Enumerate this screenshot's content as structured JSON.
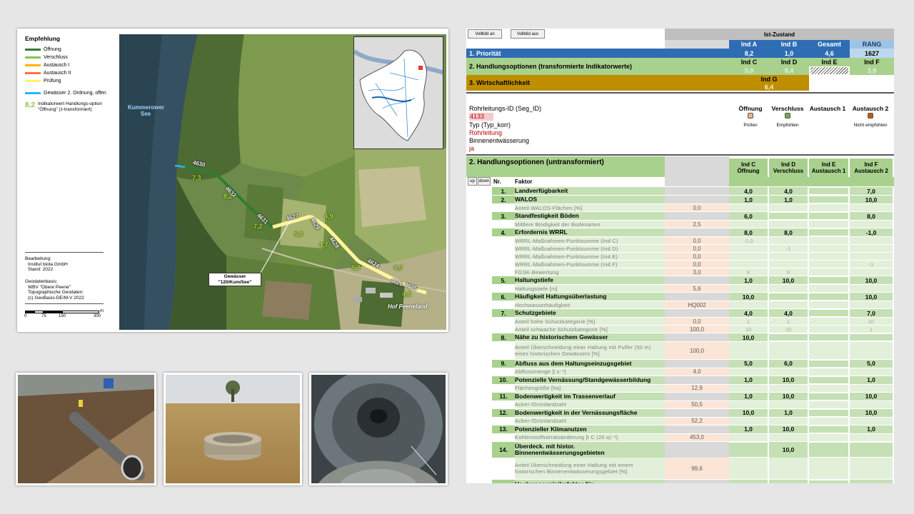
{
  "map": {
    "legend_title": "Empfehlung",
    "legend_items": [
      {
        "label": "Öffnung",
        "color": "#2e7d32"
      },
      {
        "label": "Verschluss",
        "color": "#8bc34a"
      },
      {
        "label": "Austausch I",
        "color": "#ffb300"
      },
      {
        "label": "Austausch II",
        "color": "#ff7043"
      },
      {
        "label": "Prüfung",
        "color": "#fff176"
      }
    ],
    "legend_water": {
      "label": "Gewässer 2. Ordnung, offen",
      "color": "#29b6f6"
    },
    "legend_indicator": {
      "value": "8,2",
      "text": "Indikatorwert Handlungs-option \"Öffnung\" (z-transformiert)"
    },
    "bearbeitung": [
      "Bearbeitung:",
      "Institut biota GmbH",
      "Stand: 2022"
    ],
    "geodaten": [
      "Geodatenbasis:",
      "WBV \"Obere Peene\"",
      "Topographische Geodaten:",
      "(c) GeoBasis-DE/M-V 2022"
    ],
    "scale_labels": [
      "0",
      "75",
      "150",
      "300"
    ],
    "scale_unit": "m",
    "lake_name": "Kummerower See",
    "hof_name": "Hof Peeneland",
    "gewaesser_label": [
      "Gewässer",
      "\"120/Kum/See\""
    ],
    "segments": [
      {
        "id": "4630",
        "ind": "7,3"
      },
      {
        "id": "4632",
        "ind": "8,2"
      },
      {
        "id": "4631",
        "ind": "7,2"
      },
      {
        "id": "4627",
        "ind": "5,3"
      },
      {
        "id": "4629",
        "ind": "4,9"
      },
      {
        "id": "4628",
        "ind": "4,7"
      },
      {
        "id": "4624",
        "ind": "5,3"
      },
      {
        "id": "4626",
        "ind": "4,9"
      },
      {
        "id": "4625",
        "ind": "4,8"
      }
    ]
  },
  "sheet": {
    "buttons": [
      "Vollbild an",
      "Vollbild aus"
    ],
    "ist_zustand": "Ist-Zustand",
    "top_headers": [
      "Ind A",
      "Ind B",
      "Gesamt",
      "RANG"
    ],
    "prioritaet": {
      "label": "1. Priorität",
      "values": [
        "8,2",
        "1,0",
        "4,6",
        "1627"
      ]
    },
    "handlungsoptionen_t": {
      "label": "2. Handlungsoptionen (transformierte Indikatorwerte)",
      "headers": [
        "Ind C",
        "Ind D",
        "Ind E",
        "Ind F"
      ],
      "values": [
        "5,0",
        "8,4",
        "",
        "3,9"
      ]
    },
    "wirtschaft": {
      "label": "3. Wirtschaftlichkeit",
      "header": "Ind G",
      "value": "6,4"
    },
    "info": {
      "rohr_label": "Rohrleitungs-ID (Seg_ID)",
      "rohr_value": "4133",
      "typ_label": "Typ (Typ_korr)",
      "typ_value": "Rohrleitung",
      "binnen_label": "Binnenentwässerung",
      "binnen_value": "ja",
      "options": [
        {
          "name": "Öffnung",
          "status": "Prüfen",
          "color": "#f4b183"
        },
        {
          "name": "Verschluss",
          "status": "Empfohlen",
          "color": "#70ad47"
        },
        {
          "name": "Austausch 1",
          "status": "",
          "color": ""
        },
        {
          "name": "Austausch 2",
          "status": "Nicht empfohlen",
          "color": "#c55a11"
        }
      ]
    },
    "untrans": {
      "title": "2. Handlungsoptionen (untransformiert)",
      "col_headers": [
        {
          "ind": "Ind C",
          "name": "Öffnung"
        },
        {
          "ind": "Ind D",
          "name": "Verschluss"
        },
        {
          "ind": "Ind E",
          "name": "Austausch 1"
        },
        {
          "ind": "Ind F",
          "name": "Austausch 2"
        }
      ],
      "up": "up",
      "down": "down",
      "nr_label": "Nr.",
      "faktor_label": "Faktor"
    },
    "rows": [
      {
        "type": "main",
        "nr": "1.",
        "name": "Landverfügbarkeit",
        "val": "",
        "c": "4,0",
        "d": "4,0",
        "e": "#",
        "f": "7,0"
      },
      {
        "type": "main",
        "nr": "2.",
        "name": "WALOS",
        "val": "",
        "c": "1,0",
        "d": "1,0",
        "e": "#",
        "f": "10,0"
      },
      {
        "type": "sub",
        "name": "Anteil WALOS-Flächen [%]",
        "val": "0,0",
        "c": "",
        "d": "",
        "e": "",
        "f": ""
      },
      {
        "type": "main",
        "nr": "3.",
        "name": "Standfestigkeit Böden",
        "val": "",
        "c": "6,0",
        "d": "#",
        "e": "#",
        "f": "8,0"
      },
      {
        "type": "sub",
        "name": "Mittlere Bindigkeit der Bodenarten",
        "val": "2,5",
        "c": "",
        "d": "",
        "e": "",
        "f": ""
      },
      {
        "type": "main",
        "nr": "4.",
        "name": "Erfordernis WRRL",
        "val": "",
        "c": "8,0",
        "d": "8,0",
        "e": "#",
        "f": "-1,0"
      },
      {
        "type": "sub",
        "name": "WRRL-Maßnahmen-Punktsumme (Ind C)",
        "val": "0,0",
        "c": "-1,0",
        "d": "",
        "e": "",
        "f": ""
      },
      {
        "type": "sub",
        "name": "WRRL-Maßnahmen-Punktsumme (Ind D)",
        "val": "0,0",
        "c": "",
        "d": "-1",
        "e": "",
        "f": ""
      },
      {
        "type": "sub",
        "name": "WRRL-Maßnahmen-Punktsumme (Ind E)",
        "val": "0,0",
        "c": "",
        "d": "",
        "e": "",
        "f": ""
      },
      {
        "type": "sub",
        "name": "WRRL-Maßnahmen-Punktsumme (Ind F)",
        "val": "0,0",
        "c": "",
        "d": "",
        "e": "",
        "f": "-1"
      },
      {
        "type": "sub",
        "name": "FGSK-Bewertung",
        "val": "3,0",
        "c": "8",
        "d": "8",
        "e": "",
        "f": ""
      },
      {
        "type": "main",
        "nr": "5.",
        "name": "Haltungstiefe",
        "val": "",
        "c": "1,0",
        "d": "10,0",
        "e": "#",
        "f": "10,0"
      },
      {
        "type": "sub",
        "name": "Haltungstiefe [m]",
        "val": "5,6",
        "c": "",
        "d": "",
        "e": "",
        "f": ""
      },
      {
        "type": "main",
        "nr": "6.",
        "name": "Häufigkeit Haltungsüberlastung",
        "val": "",
        "c": "10,0",
        "d": "#",
        "e": "#",
        "f": "10,0"
      },
      {
        "type": "sub",
        "name": "Hochwasserhäufigkeit",
        "val": "HQ002",
        "c": "",
        "d": "",
        "e": "",
        "f": ""
      },
      {
        "type": "main",
        "nr": "7.",
        "name": "Schutzgebiete",
        "val": "",
        "c": "4,0",
        "d": "4,0",
        "e": "#",
        "f": "7,0"
      },
      {
        "type": "sub",
        "name": "Anteil hohe Schutzkategorie [%]",
        "val": "0,0",
        "c": "1",
        "d": "1",
        "e": "",
        "f": "10"
      },
      {
        "type": "sub",
        "name": "Anteil schwache Schutzkategorie [%]",
        "val": "100,0",
        "c": "10",
        "d": "10",
        "e": "",
        "f": "1"
      },
      {
        "type": "main",
        "nr": "8.",
        "name": "Nähe zu historischem Gewässer",
        "val": "",
        "c": "10,0",
        "d": "#",
        "e": "#",
        "f": "#"
      },
      {
        "type": "sub2",
        "name": "Anteil Überschneidung einer Haltung mit Puffer (50 m) eines historischen Gewässers [%]",
        "val": "100,0",
        "c": "",
        "d": "",
        "e": "",
        "f": ""
      },
      {
        "type": "main",
        "nr": "9.",
        "name": "Abfluss aus dem Haltungseinzugsgebiet",
        "val": "",
        "c": "5,0",
        "d": "6,0",
        "e": "#",
        "f": "5,0"
      },
      {
        "type": "sub",
        "name": "Abflussmenge [l s⁻¹]",
        "val": "4,0",
        "c": "",
        "d": "",
        "e": "",
        "f": ""
      },
      {
        "type": "main",
        "nr": "10.",
        "name": "Potenzielle Vernässung/Standgewässerbildung",
        "val": "",
        "c": "1,0",
        "d": "10,0",
        "e": "#",
        "f": "1,0"
      },
      {
        "type": "sub",
        "name": "Flächengröße [ha]",
        "val": "12,9",
        "c": "",
        "d": "",
        "e": "",
        "f": ""
      },
      {
        "type": "main",
        "nr": "11.",
        "name": "Bodenwertigkeit im Trassenverlauf",
        "val": "",
        "c": "1,0",
        "d": "10,0",
        "e": "#",
        "f": "10,0"
      },
      {
        "type": "sub",
        "name": "Acker-/Grünlandzahl",
        "val": "50,5",
        "c": "",
        "d": "",
        "e": "",
        "f": ""
      },
      {
        "type": "main",
        "nr": "12.",
        "name": "Bodenwertigkeit in der Vernässungsfläche",
        "val": "",
        "c": "10,0",
        "d": "1,0",
        "e": "#",
        "f": "10,0"
      },
      {
        "type": "sub",
        "name": "Acker-/Grünlandzahl",
        "val": "52,2",
        "c": "",
        "d": "",
        "e": "",
        "f": ""
      },
      {
        "type": "main",
        "nr": "13.",
        "name": "Potenzieller Klimanutzen",
        "val": "",
        "c": "1,0",
        "d": "10,0",
        "e": "#",
        "f": "1,0"
      },
      {
        "type": "sub",
        "name": "Kohlenstoffvorratsänderung [t C (20 a)⁻¹]",
        "val": "453,0",
        "c": "",
        "d": "",
        "e": "",
        "f": ""
      },
      {
        "type": "main2",
        "nr": "14.",
        "name": "Überdeck. mit histor. Binnenentwässerungsgebieten",
        "val": "",
        "c": "#",
        "d": "10,0",
        "e": "#",
        "f": "#"
      },
      {
        "type": "sub3",
        "name": "Anteil Überschneidung einer Haltung mit einem historischen Binnenentwässerungsgebiet [%]",
        "val": "99,6",
        "c": "",
        "d": "",
        "e": "",
        "f": ""
      },
      {
        "type": "main2",
        "nr": "15.",
        "name": "Hochwasserrisikofaktor für Binnenentwässerungsgebiete",
        "val": "",
        "c": "10,0",
        "d": "10,0",
        "e": "#",
        "f": "10,0"
      }
    ]
  }
}
